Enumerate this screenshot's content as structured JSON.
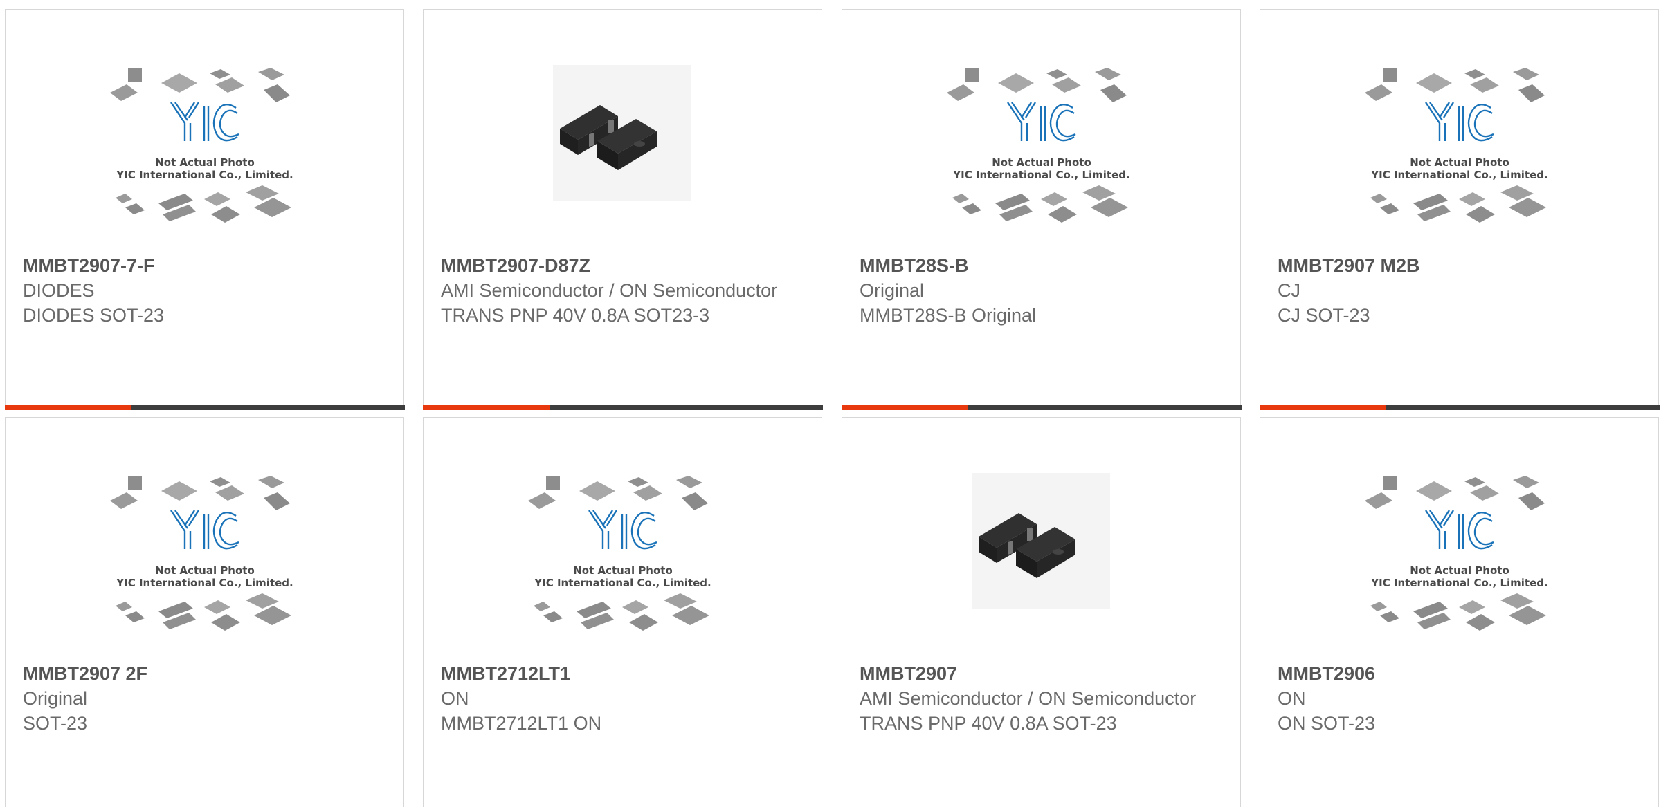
{
  "products": [
    {
      "part_number": "MMBT2907-7-F",
      "manufacturer": "DIODES",
      "description": "DIODES SOT-23",
      "image": "placeholder"
    },
    {
      "part_number": "MMBT2907-D87Z",
      "manufacturer": "AMI Semiconductor / ON Semiconductor",
      "description": "TRANS PNP 40V 0.8A SOT23-3",
      "image": "sot23-photo"
    },
    {
      "part_number": "MMBT28S-B",
      "manufacturer": "Original",
      "description": "MMBT28S-B Original",
      "image": "placeholder"
    },
    {
      "part_number": "MMBT2907 M2B",
      "manufacturer": "CJ",
      "description": "CJ SOT-23",
      "image": "placeholder"
    },
    {
      "part_number": "MMBT2907 2F",
      "manufacturer": "Original",
      "description": "SOT-23",
      "image": "placeholder"
    },
    {
      "part_number": "MMBT2712LT1",
      "manufacturer": "ON",
      "description": "MMBT2712LT1 ON",
      "image": "placeholder"
    },
    {
      "part_number": "MMBT2907",
      "manufacturer": "AMI Semiconductor / ON Semiconductor",
      "description": "TRANS PNP 40V 0.8A SOT-23",
      "image": "sot23-photo"
    },
    {
      "part_number": "MMBT2906",
      "manufacturer": "ON",
      "description": "ON SOT-23",
      "image": "placeholder"
    }
  ],
  "placeholder": {
    "logo_text": "YIC",
    "caption_line1": "Not Actual Photo",
    "caption_line2": "YIC International Co., Limited."
  },
  "colors": {
    "accent": "#e8380d",
    "bar": "#3d3d3d",
    "logo_blue": "#1a73b8"
  }
}
